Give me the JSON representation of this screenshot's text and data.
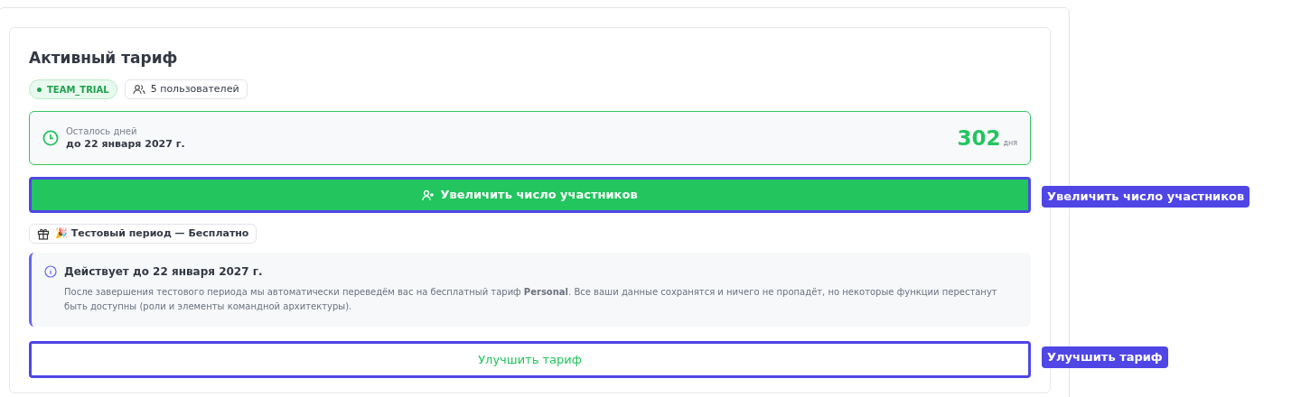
{
  "title": "Активный тариф",
  "plan_badge": {
    "label": "TEAM_TRIAL"
  },
  "users_badge": {
    "label": "5 пользователей"
  },
  "remaining": {
    "label": "Осталось дней",
    "date": "до 22 января 2027 г.",
    "count": "302",
    "unit": "дня"
  },
  "add_members_button": {
    "label": "Увеличить число участников",
    "annotation": "Увеличить число участников"
  },
  "trial_badge": {
    "label": "🎉 Тестовый период — Бесплатно"
  },
  "notice": {
    "title": "Действует до 22 января 2027 г.",
    "text": "После завершения тестового периода мы автоматически переведём вас на бесплатный тариф **Personal**. Все ваши данные сохранятся и ничего не пропадёт, но некоторые функции перестанут быть доступны (роли и элементы командной архитектуры)."
  },
  "upgrade_button": {
    "label": "Улучшить тариф",
    "annotation": "Улучшить тариф"
  }
}
